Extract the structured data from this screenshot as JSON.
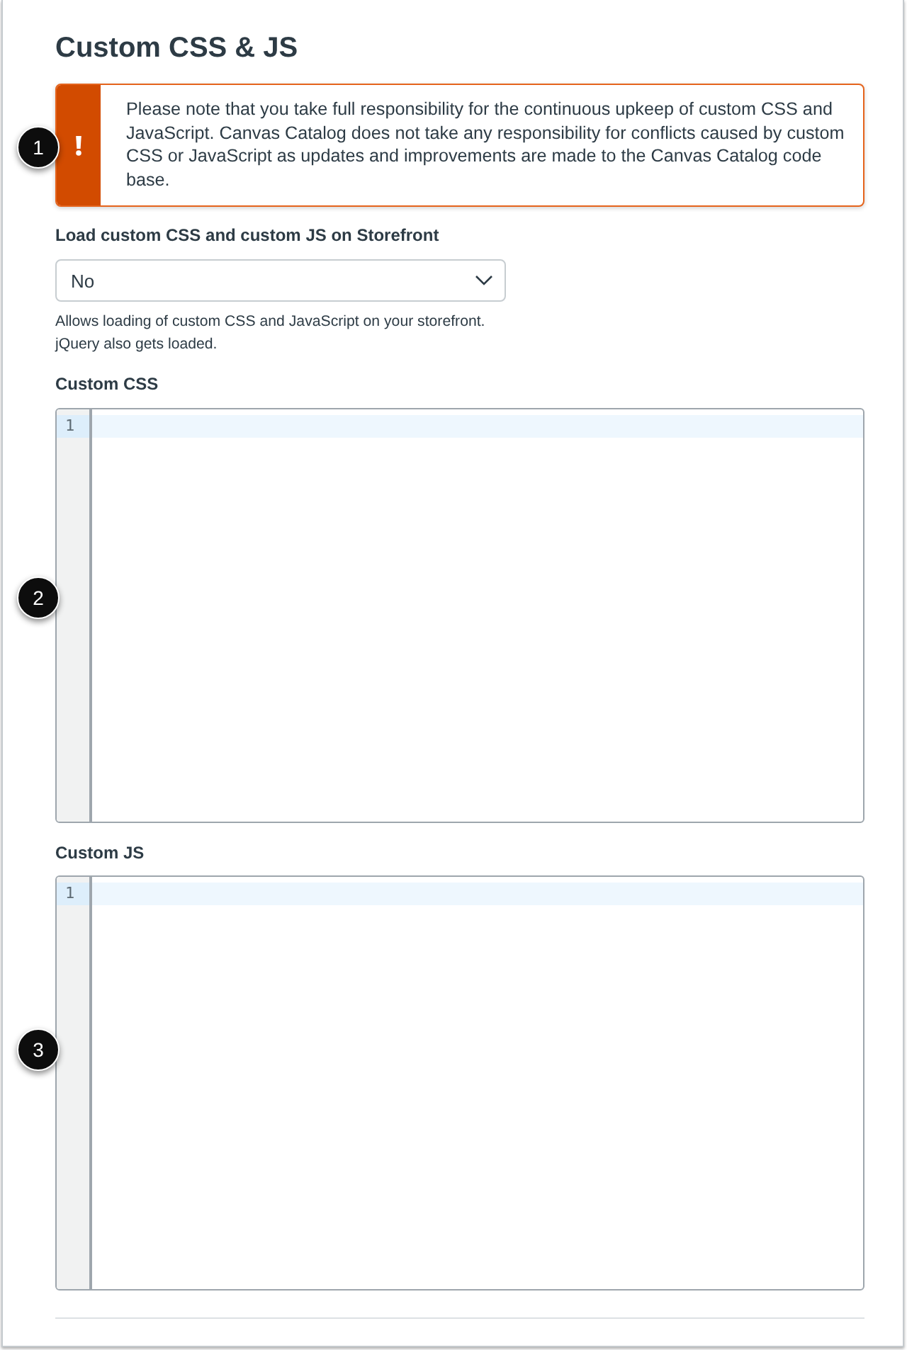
{
  "page": {
    "title": "Custom CSS & JS"
  },
  "alert": {
    "kind": "warning",
    "message": "Please note that you take full responsibility for the continuous upkeep of custom CSS and JavaScript. Canvas Catalog does not take any responsibility for conflicts caused by custom CSS or JavaScript as updates and improvements are made to the Canvas Catalog code base.",
    "callout": "1"
  },
  "storefront_setting": {
    "label": "Load custom CSS and custom JS on Storefront",
    "value": "No",
    "help": "Allows loading of custom CSS and JavaScript on your storefront. jQuery also gets loaded."
  },
  "editors": [
    {
      "label": "Custom CSS",
      "callout": "2",
      "lines": [
        {
          "number": "1",
          "active": true
        }
      ]
    },
    {
      "label": "Custom JS",
      "callout": "3",
      "lines": [
        {
          "number": "1",
          "active": true
        }
      ]
    }
  ]
}
